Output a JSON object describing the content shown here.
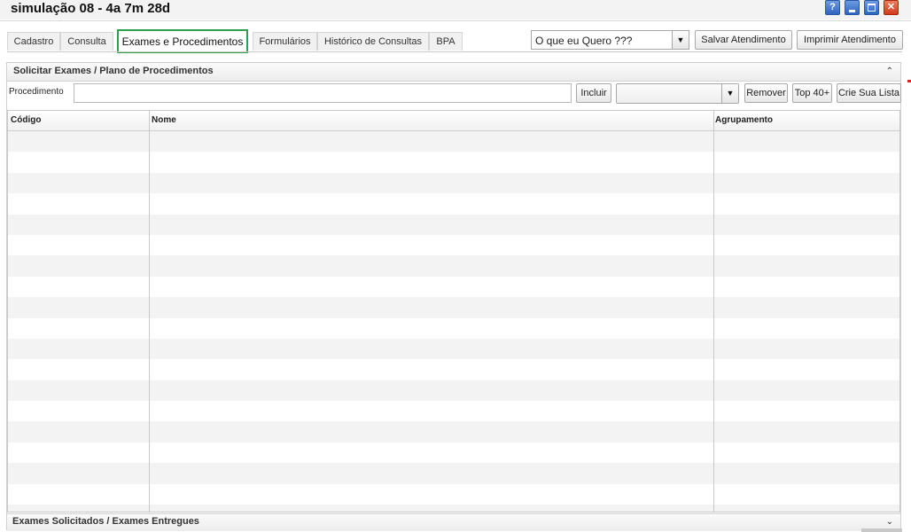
{
  "window": {
    "title": "simulação 08 - 4a 7m 28d",
    "controls": {
      "help": "?",
      "close": "✕"
    }
  },
  "tabs": [
    {
      "label": "Cadastro",
      "active": false
    },
    {
      "label": "Consulta",
      "active": false
    },
    {
      "label": "Exames e Procedimentos",
      "active": true
    },
    {
      "label": "Formulários",
      "active": false
    },
    {
      "label": "Histórico de Consultas",
      "active": false
    },
    {
      "label": "BPA",
      "active": false
    }
  ],
  "toolbar": {
    "dropdown_value": "O que eu Quero ???",
    "save_label": "Salvar Atendimento",
    "print_label": "Imprimir Atendimento"
  },
  "panel": {
    "title": "Solicitar Exames / Plano de Procedimentos",
    "procedure_label": "Procedimento",
    "procedure_value": "",
    "include_label": "Incluir",
    "list_select_value": "",
    "remove_label": "Remover",
    "top_label": "Top 40+",
    "create_list_label": "Crie Sua Lista"
  },
  "grid": {
    "columns": [
      "Código",
      "Nome",
      "Agrupamento"
    ],
    "rows": []
  },
  "bottom_panel": {
    "title": "Exames Solicitados / Exames Entregues"
  },
  "colors": {
    "active_tab_border": "#2e9e4f",
    "window_button_blue": "#2f64c0",
    "window_close_red": "#d23b1c",
    "grid_stripe": "#f3f3f3"
  }
}
